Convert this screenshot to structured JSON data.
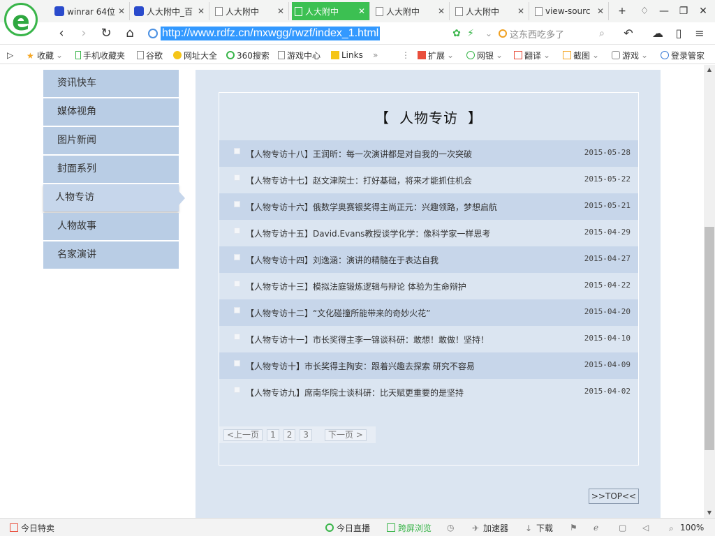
{
  "browser": {
    "tabs": [
      {
        "label": "winrar 64位",
        "icon": "paw-icon",
        "active": false
      },
      {
        "label": "人大附中_百",
        "icon": "paw-icon",
        "active": false
      },
      {
        "label": "人大附中",
        "icon": "page-icon",
        "active": false
      },
      {
        "label": "人大附中",
        "icon": "page-icon",
        "active": true
      },
      {
        "label": "人大附中",
        "icon": "page-icon",
        "active": false
      },
      {
        "label": "人大附中",
        "icon": "page-icon",
        "active": false
      },
      {
        "label": "view-sourc",
        "icon": "page-icon",
        "active": false
      }
    ],
    "url": "http://www.rdfz.cn/mxwgg/rwzf/index_1.html",
    "search_placeholder": "这东西吃多了",
    "bookmarks": [
      "收藏",
      "手机收藏夹",
      "谷歌",
      "网址大全",
      "360搜索",
      "游戏中心",
      "Links"
    ],
    "toolbar_right": [
      "扩展",
      "网银",
      "翻译",
      "截图",
      "游戏",
      "登录管家"
    ],
    "accent_color": "#3cc052"
  },
  "sidenav": {
    "items": [
      {
        "label": "资讯快车"
      },
      {
        "label": "媒体视角"
      },
      {
        "label": "图片新闻"
      },
      {
        "label": "封面系列"
      },
      {
        "label": "人物专访",
        "active": true
      },
      {
        "label": "人物故事"
      },
      {
        "label": "名家演讲"
      }
    ]
  },
  "section": {
    "bracket_left": "【",
    "title": "人物专访",
    "bracket_right": "】"
  },
  "articles": [
    {
      "title": "【人物专访十八】王润昕：每一次演讲都是对自我的一次突破",
      "date": "2015-05-28"
    },
    {
      "title": "【人物专访十七】赵文津院士：打好基础，将来才能抓住机会",
      "date": "2015-05-22"
    },
    {
      "title": "【人物专访十六】俄数学奥赛银奖得主尚正元：兴趣领路，梦想启航",
      "date": "2015-05-21"
    },
    {
      "title": "【人物专访十五】David.Evans教授谈学化学：像科学家一样思考",
      "date": "2015-04-29"
    },
    {
      "title": "【人物专访十四】刘逸涵：演讲的精髓在于表达自我",
      "date": "2015-04-27"
    },
    {
      "title": "【人物专访十三】模拟法庭锻炼逻辑与辩论 体验为生命辩护",
      "date": "2015-04-22"
    },
    {
      "title": "【人物专访十二】“文化碰撞所能带来的奇妙火花”",
      "date": "2015-04-20"
    },
    {
      "title": "【人物专访十一】市长奖得主李一锦谈科研：敢想！敢做！坚持！",
      "date": "2015-04-10"
    },
    {
      "title": "【人物专访十】市长奖得主陶安：跟着兴趣去探索 研究不容易",
      "date": "2015-04-09"
    },
    {
      "title": "【人物专访九】席南华院士谈科研：比天赋更重要的是坚持",
      "date": "2015-04-02"
    }
  ],
  "pager": {
    "prev": "<上一页",
    "pages": [
      "1",
      "2",
      "3"
    ],
    "next": "下一页 >"
  },
  "top_button": ">>TOP<<",
  "statusbar": {
    "left": "今日特卖",
    "items": [
      "今日直播",
      "跨屏浏览",
      "加速器",
      "下载"
    ],
    "zoom": "100%"
  }
}
